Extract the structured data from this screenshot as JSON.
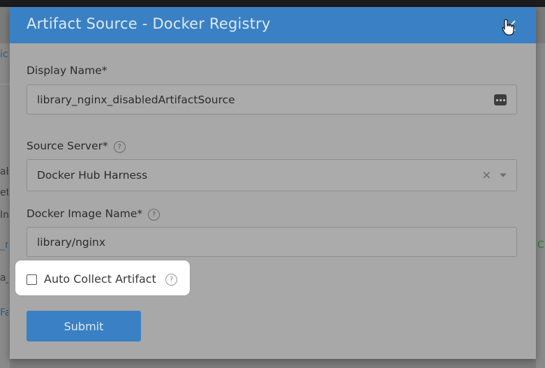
{
  "dialog": {
    "title": "Artifact Source - Docker Registry"
  },
  "fields": {
    "display_name": {
      "label": "Display Name*",
      "value": "library_nginx_disabledArtifactSource"
    },
    "source_server": {
      "label": "Source Server*",
      "value": "Docker Hub Harness"
    },
    "docker_image_name": {
      "label": "Docker Image Name*",
      "value": "library/nginx"
    }
  },
  "auto_collect": {
    "label": "Auto Collect Artifact",
    "checked": false
  },
  "submit_label": "Submit",
  "background_fragments": [
    "ic",
    "ab",
    "et",
    "In",
    "_r",
    "a_",
    "Fa",
    "C"
  ],
  "icons": {
    "close": "close-icon",
    "cursor": "hand-pointer-icon",
    "help": "help-circle-icon",
    "dots": "dots-menu-icon",
    "clear": "clear-x-icon",
    "caret": "chevron-down-icon"
  },
  "colors": {
    "header": "#3a80c4",
    "submit": "#3a80c4",
    "overlay": "#a8a8a8",
    "highlight": "#ffffff"
  }
}
